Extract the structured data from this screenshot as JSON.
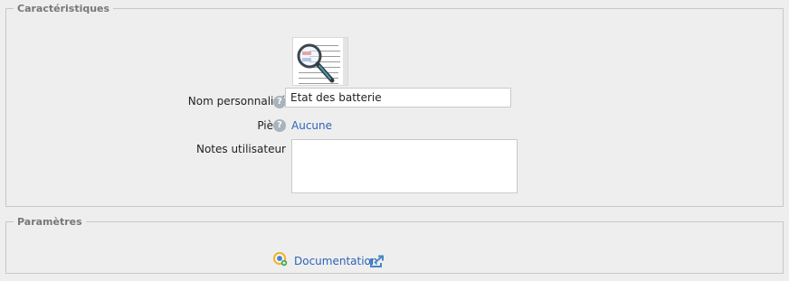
{
  "characteristics": {
    "legend": "Caractéristiques",
    "name_label": "Nom personnalisé",
    "name_value": "Etat des batterie",
    "room_label": "Pièce",
    "room_value": "Aucune",
    "notes_label": "Notes utilisateur",
    "notes_value": "",
    "help_glyph": "?"
  },
  "parameters": {
    "legend": "Paramètres",
    "doc_link": "Documentation"
  },
  "icons": {
    "thumbnail": "battery-status-preview-magnifier-icon",
    "help": "help-icon",
    "documentation": "documentation-icon",
    "external": "external-link-icon"
  },
  "colors": {
    "link": "#2e64b8",
    "background": "#eeeeee",
    "help_icon": "#a9b3bd"
  }
}
